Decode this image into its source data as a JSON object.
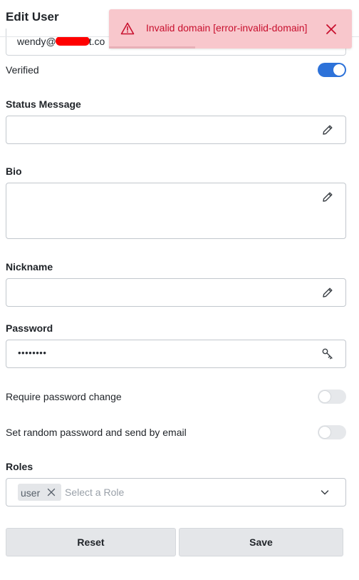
{
  "header": {
    "title": "Edit User"
  },
  "email": {
    "prefix": "wendy@",
    "suffix": "t.co"
  },
  "toast": {
    "message": "Invalid domain [error-invalid-domain]",
    "color": "#c8102e",
    "background": "#f8c7cc"
  },
  "verified": {
    "label": "Verified",
    "on": true
  },
  "status_message": {
    "label": "Status Message",
    "value": ""
  },
  "bio": {
    "label": "Bio",
    "value": ""
  },
  "nickname": {
    "label": "Nickname",
    "value": ""
  },
  "password": {
    "label": "Password",
    "value": "••••••••"
  },
  "require_password_change": {
    "label": "Require password change",
    "on": false
  },
  "random_password": {
    "label": "Set random password and send by email",
    "on": false
  },
  "roles": {
    "label": "Roles",
    "selected": [
      "user"
    ],
    "placeholder": "Select a Role"
  },
  "buttons": {
    "reset": "Reset",
    "save": "Save"
  },
  "colors": {
    "accent": "#2d72d9",
    "button_bg": "#e4e6e9"
  },
  "icons": {
    "edit": "pencil-icon",
    "password": "key-icon",
    "warning": "warning-triangle-icon",
    "close": "close-icon",
    "dropdown": "chevron-down-icon"
  }
}
